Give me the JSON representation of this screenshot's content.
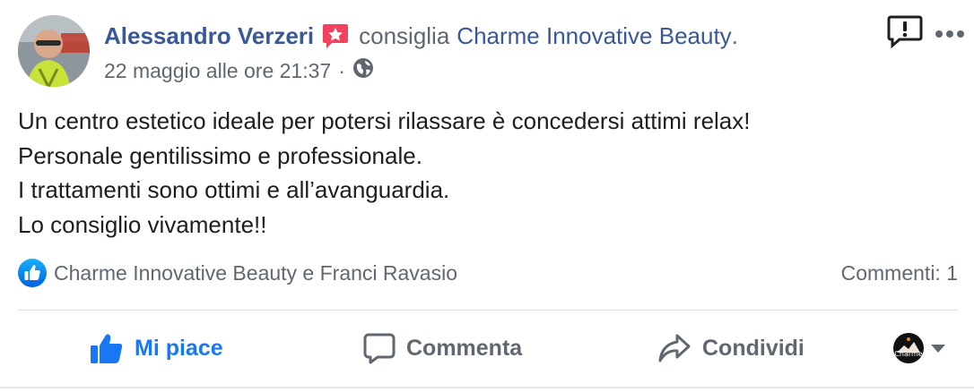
{
  "post": {
    "author": "Alessandro Verzeri",
    "action_text": "consiglia",
    "page_name": "Charme Innovative Beauty",
    "page_suffix": ".",
    "timestamp": "22 maggio alle ore 21:37",
    "separator": "·",
    "privacy_icon": "globe-icon",
    "badge_icon": "recommendation-star-icon",
    "body_lines": [
      "Un centro estetico ideale per potersi rilassare è concedersi attimi relax!",
      "Personale gentilissimo e professionale.",
      "I trattamenti sono ottimi e all’avanguardia.",
      "Lo consiglio vivamente!!"
    ]
  },
  "reactions": {
    "icon": "like-icon",
    "names": "Charme Innovative Beauty e Franci Ravasio",
    "comments_count": "Commenti: 1"
  },
  "actions": {
    "like_label": "Mi piace",
    "comment_label": "Commenta",
    "share_label": "Condividi"
  },
  "page_selector": {
    "avatar_text": "Charme"
  },
  "colors": {
    "link": "#385898",
    "muted": "#606770",
    "like_blue": "#1877f2",
    "badge_pink": "#f3425f"
  }
}
